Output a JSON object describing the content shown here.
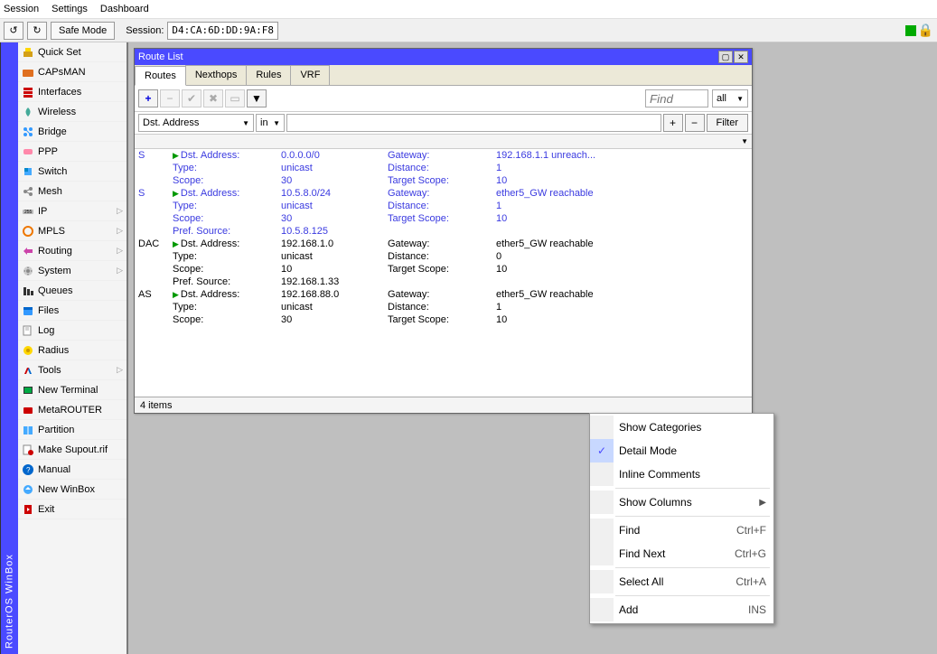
{
  "menubar": {
    "items": [
      "Session",
      "Settings",
      "Dashboard"
    ]
  },
  "toolbar": {
    "undo": "↺",
    "redo": "↻",
    "safe_mode": "Safe Mode",
    "session_label": "Session:",
    "session_id": "D4:CA:6D:DD:9A:F8"
  },
  "vtab": "RouterOS WinBox",
  "sidebar": {
    "items": [
      {
        "label": "Quick Set"
      },
      {
        "label": "CAPsMAN"
      },
      {
        "label": "Interfaces"
      },
      {
        "label": "Wireless"
      },
      {
        "label": "Bridge"
      },
      {
        "label": "PPP"
      },
      {
        "label": "Switch"
      },
      {
        "label": "Mesh"
      },
      {
        "label": "IP",
        "sub": true
      },
      {
        "label": "MPLS",
        "sub": true
      },
      {
        "label": "Routing",
        "sub": true
      },
      {
        "label": "System",
        "sub": true
      },
      {
        "label": "Queues"
      },
      {
        "label": "Files"
      },
      {
        "label": "Log"
      },
      {
        "label": "Radius"
      },
      {
        "label": "Tools",
        "sub": true
      },
      {
        "label": "New Terminal"
      },
      {
        "label": "MetaROUTER"
      },
      {
        "label": "Partition"
      },
      {
        "label": "Make Supout.rif"
      },
      {
        "label": "Manual"
      },
      {
        "label": "New WinBox"
      },
      {
        "label": "Exit"
      }
    ]
  },
  "window": {
    "title": "Route List",
    "tabs": [
      "Routes",
      "Nexthops",
      "Rules",
      "VRF"
    ],
    "active_tab": 0,
    "find_placeholder": "Find",
    "all_label": "all",
    "filter": {
      "field": "Dst. Address",
      "op": "in",
      "btn": "Filter"
    },
    "status": "4 items"
  },
  "routes": [
    {
      "flag": "S",
      "blue": true,
      "rows": [
        [
          "Dst. Address:",
          "0.0.0.0/0",
          "Gateway:",
          "192.168.1.1 unreach..."
        ],
        [
          "Type:",
          "unicast",
          "Distance:",
          "1"
        ],
        [
          "Scope:",
          "30",
          "Target Scope:",
          "10"
        ]
      ]
    },
    {
      "flag": "S",
      "blue": true,
      "rows": [
        [
          "Dst. Address:",
          "10.5.8.0/24",
          "Gateway:",
          "ether5_GW reachable"
        ],
        [
          "Type:",
          "unicast",
          "Distance:",
          "1"
        ],
        [
          "Scope:",
          "30",
          "Target Scope:",
          "10"
        ],
        [
          "Pref. Source:",
          "10.5.8.125",
          "",
          ""
        ]
      ]
    },
    {
      "flag": "DAC",
      "blue": false,
      "rows": [
        [
          "Dst. Address:",
          "192.168.1.0",
          "Gateway:",
          "ether5_GW reachable"
        ],
        [
          "Type:",
          "unicast",
          "Distance:",
          "0"
        ],
        [
          "Scope:",
          "10",
          "Target Scope:",
          "10"
        ],
        [
          "Pref. Source:",
          "192.168.1.33",
          "",
          ""
        ]
      ]
    },
    {
      "flag": "AS",
      "blue": false,
      "rows": [
        [
          "Dst. Address:",
          "192.168.88.0",
          "Gateway:",
          "ether5_GW reachable"
        ],
        [
          "Type:",
          "unicast",
          "Distance:",
          "1"
        ],
        [
          "Scope:",
          "30",
          "Target Scope:",
          "10"
        ]
      ]
    }
  ],
  "context_menu": {
    "items": [
      {
        "label": "Show Categories",
        "checked": false
      },
      {
        "label": "Detail Mode",
        "checked": true
      },
      {
        "label": "Inline Comments",
        "checked": false
      },
      {
        "sep": true
      },
      {
        "label": "Show Columns",
        "sub": true
      },
      {
        "sep": true
      },
      {
        "label": "Find",
        "shortcut": "Ctrl+F"
      },
      {
        "label": "Find Next",
        "shortcut": "Ctrl+G"
      },
      {
        "sep": true
      },
      {
        "label": "Select All",
        "shortcut": "Ctrl+A"
      },
      {
        "sep": true
      },
      {
        "label": "Add",
        "shortcut": "INS"
      }
    ]
  }
}
